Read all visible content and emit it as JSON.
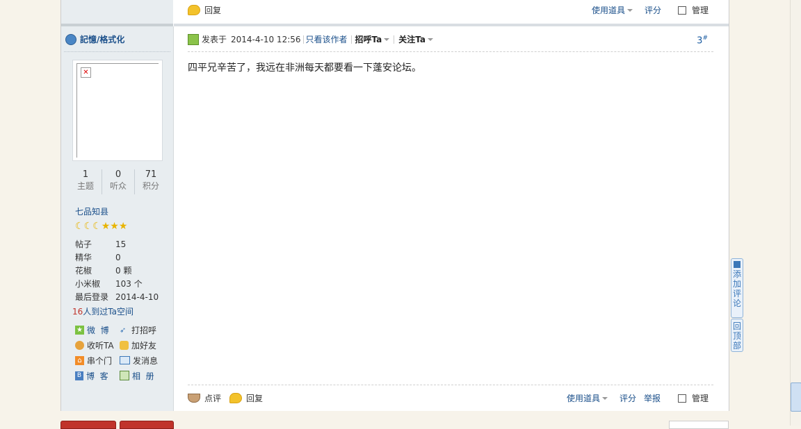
{
  "top_bar": {
    "reply_label": "回复",
    "use_item_label": "使用道具",
    "rate_label": "评分",
    "manage_label": "管理"
  },
  "user": {
    "name": "記憶/格式化",
    "stats": [
      {
        "value": "1",
        "label": "主题"
      },
      {
        "value": "0",
        "label": "听众"
      },
      {
        "value": "71",
        "label": "积分"
      }
    ],
    "rank": "七品知县",
    "rank_stars": {
      "moons": 3,
      "stars": 3
    },
    "details": [
      {
        "key": "帖子",
        "value": "15"
      },
      {
        "key": "精华",
        "value": "0"
      },
      {
        "key": "花椒",
        "value": "0 颗"
      },
      {
        "key": "小米椒",
        "value": "103 个"
      },
      {
        "key": "最后登录",
        "value": "2014-4-10"
      }
    ],
    "visits_count": "16",
    "visits_text": "人到过Ta空间",
    "actions": [
      {
        "label": "微  博",
        "icon": "weibo-icon"
      },
      {
        "label": "打招呼",
        "icon": "wave-icon"
      },
      {
        "label": "收听TA",
        "icon": "follow-icon"
      },
      {
        "label": "加好友",
        "icon": "handshake-icon"
      },
      {
        "label": "串个门",
        "icon": "home-icon"
      },
      {
        "label": "发消息",
        "icon": "envelope-icon"
      },
      {
        "label": "博  客",
        "icon": "blog-icon"
      },
      {
        "label": "相  册",
        "icon": "album-icon"
      }
    ]
  },
  "post": {
    "posted_label": "发表于",
    "date": "2014-4-10 12:56",
    "author_only_label": "只看该作者",
    "greet_label": "招呼Ta",
    "follow_label": "关注Ta",
    "floor_number": "3",
    "floor_suffix": "#",
    "content": "四平兄辛苦了，我远在非洲每天都要看一下蓬安论坛。"
  },
  "post_footer": {
    "comment_label": "点评",
    "reply_label": "回复",
    "use_item_label": "使用道具",
    "rate_label": "评分",
    "report_label": "举报",
    "manage_label": "管理"
  },
  "side_tabs": {
    "add_comment": "添加评论",
    "back_top": "回顶部"
  },
  "colors": {
    "accent_blue": "#1a5ba1",
    "sidebar_bg": "#e8edf0",
    "page_bg": "#f7f3ea",
    "red_button": "#c0332b"
  }
}
